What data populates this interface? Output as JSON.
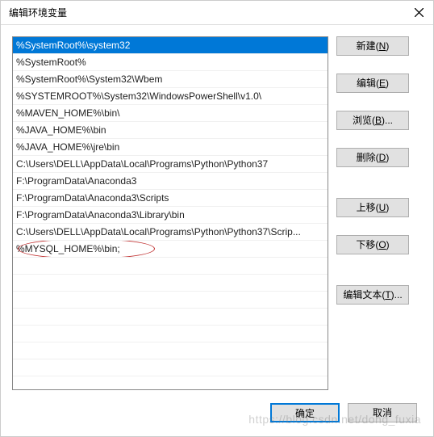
{
  "window": {
    "title": "编辑环境变量"
  },
  "list": {
    "items": [
      {
        "text": "%SystemRoot%\\system32",
        "selected": true
      },
      {
        "text": "%SystemRoot%"
      },
      {
        "text": "%SystemRoot%\\System32\\Wbem"
      },
      {
        "text": "%SYSTEMROOT%\\System32\\WindowsPowerShell\\v1.0\\"
      },
      {
        "text": "%MAVEN_HOME%\\bin\\"
      },
      {
        "text": "%JAVA_HOME%\\bin"
      },
      {
        "text": "%JAVA_HOME%\\jre\\bin"
      },
      {
        "text": "C:\\Users\\DELL\\AppData\\Local\\Programs\\Python\\Python37"
      },
      {
        "text": "F:\\ProgramData\\Anaconda3"
      },
      {
        "text": "F:\\ProgramData\\Anaconda3\\Scripts"
      },
      {
        "text": "F:\\ProgramData\\Anaconda3\\Library\\bin"
      },
      {
        "text": "C:\\Users\\DELL\\AppData\\Local\\Programs\\Python\\Python37\\Scrip..."
      },
      {
        "text": "%MYSQL_HOME%\\bin;",
        "circled": true
      }
    ]
  },
  "buttons": {
    "new": {
      "label": "新建",
      "hotkey": "N"
    },
    "edit": {
      "label": "编辑",
      "hotkey": "E"
    },
    "browse": {
      "label": "浏览",
      "hotkey": "B",
      "suffix": "..."
    },
    "delete": {
      "label": "删除",
      "hotkey": "D"
    },
    "moveup": {
      "label": "上移",
      "hotkey": "U"
    },
    "movedown": {
      "label": "下移",
      "hotkey": "O"
    },
    "edittext": {
      "label": "编辑文本",
      "hotkey": "T",
      "suffix": "..."
    }
  },
  "footer": {
    "ok": "确定",
    "cancel": "取消"
  },
  "watermark": "https://blog.csdn.net/dong_fuxia"
}
